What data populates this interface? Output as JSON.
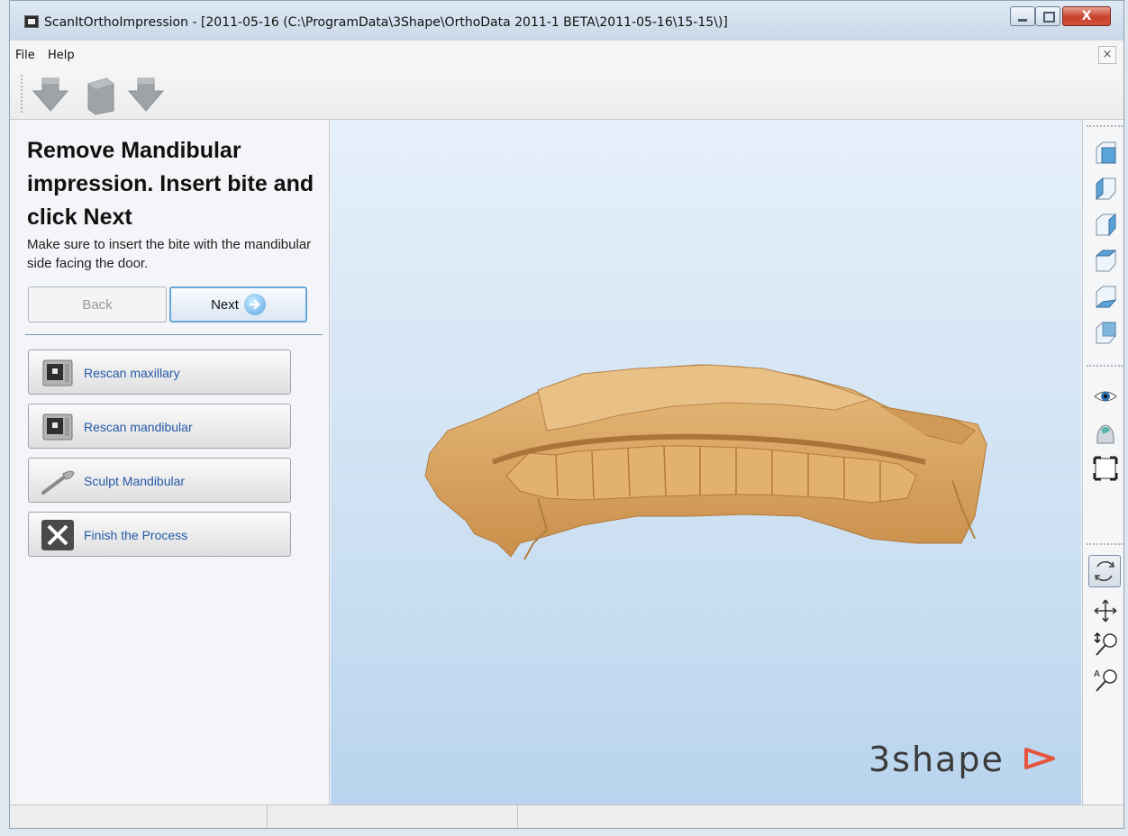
{
  "window": {
    "title": "ScanItOrthoImpression - [2011-05-16 (C:\\ProgramData\\3Shape\\OrthoData 2011-1 BETA\\2011-05-16\\15-15\\)]",
    "close_glyph": "X",
    "mdi_close_glyph": "×"
  },
  "menu": {
    "file": "File",
    "help": "Help"
  },
  "toolbar": {
    "icons": [
      "scan-down-arrow-icon",
      "scan-box-icon",
      "scan-down-arrow-icon"
    ]
  },
  "panel": {
    "title": "Remove Mandibular impression. Insert bite and click Next",
    "instruction": "Make sure to insert the bite with the mandibular side facing the door.",
    "back_label": "Back",
    "next_label": "Next",
    "actions": [
      {
        "label": "Rescan maxillary",
        "icon": "scanner-icon"
      },
      {
        "label": "Rescan mandibular",
        "icon": "scanner-icon"
      },
      {
        "label": "Sculpt Mandibular",
        "icon": "sculpt-tool-icon"
      },
      {
        "label": "Finish the Process",
        "icon": "close-x-icon"
      }
    ]
  },
  "viewport": {
    "brand": "3shape",
    "background_top": "#e6f0fa",
    "background_bottom": "#b9d4ee",
    "model_color": "#d9a562"
  },
  "right_toolbar": {
    "view_icons": [
      "view-front-cube-icon",
      "view-left-cube-icon",
      "view-right-cube-icon",
      "view-top-cube-icon",
      "view-bottom-cube-icon",
      "view-back-cube-icon"
    ],
    "display_icons": [
      "visibility-eye-icon",
      "tooth-model-icon",
      "fit-frame-icon"
    ],
    "nav_icons": [
      "rotate-icon",
      "pan-icon",
      "zoom-icon",
      "auto-zoom-icon"
    ],
    "active": "rotate-icon"
  },
  "statusbar": {
    "cells": [
      "",
      "",
      ""
    ]
  }
}
